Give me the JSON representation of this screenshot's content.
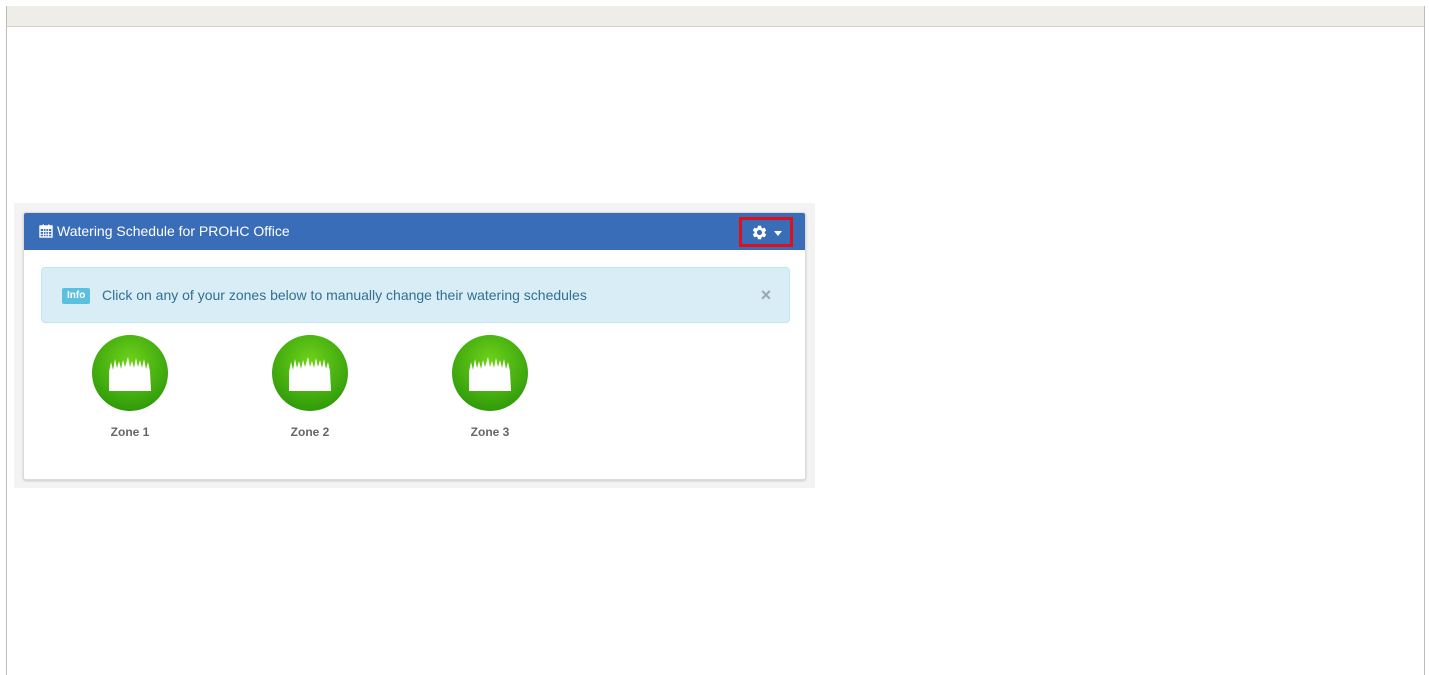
{
  "panel": {
    "title": "Watering Schedule for PROHC Office",
    "title_icon": "calendar-icon",
    "settings_icon": "gear-icon",
    "accent_color": "#3a6db7",
    "highlight_color": "#e0101a"
  },
  "alert": {
    "label": "Info",
    "message": "Click on any of your zones below to manually change their watering schedules",
    "close_glyph": "×"
  },
  "zones": [
    {
      "label": "Zone 1",
      "icon": "grass-icon"
    },
    {
      "label": "Zone 2",
      "icon": "grass-icon"
    },
    {
      "label": "Zone 3",
      "icon": "grass-icon"
    }
  ]
}
